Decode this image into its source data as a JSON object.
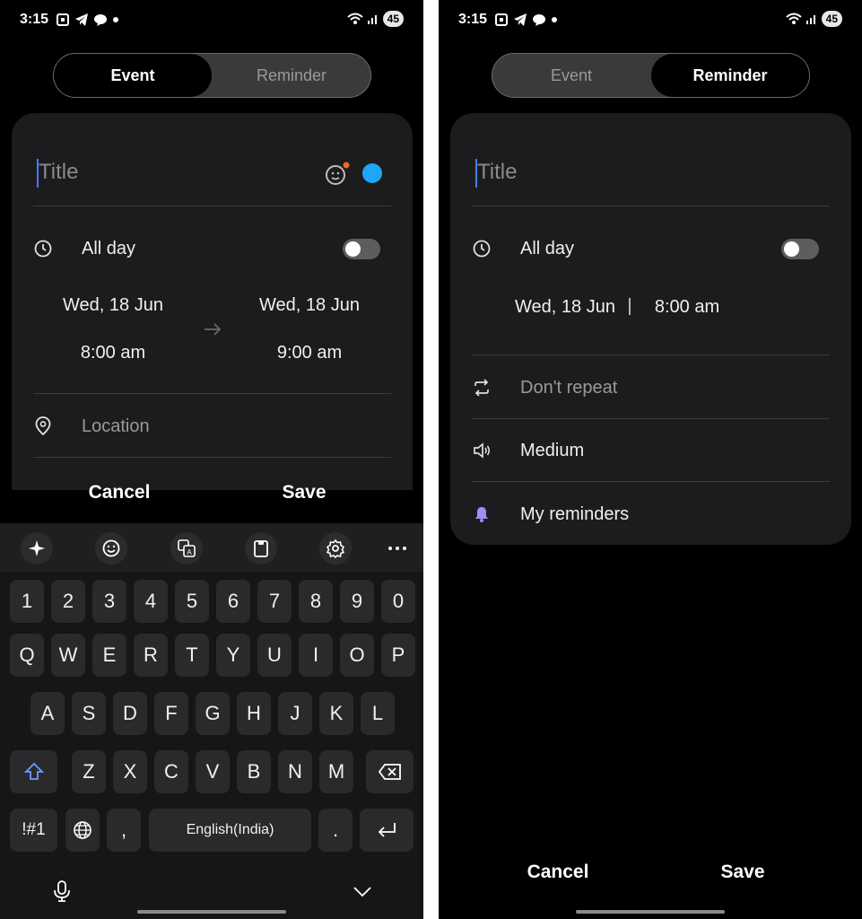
{
  "status": {
    "time": "3:15",
    "battery": "45"
  },
  "left": {
    "segmented": {
      "event": "Event",
      "reminder": "Reminder",
      "active": "Event"
    },
    "title_placeholder": "Title",
    "all_day": "All day",
    "start_date": "Wed, 18 Jun",
    "start_time": "8:00 am",
    "end_date": "Wed, 18 Jun",
    "end_time": "9:00 am",
    "location_placeholder": "Location",
    "cancel": "Cancel",
    "save": "Save",
    "colors": {
      "event_color": "#1fa6f5",
      "badge_dot": "#f06a1e"
    }
  },
  "keyboard": {
    "row_numbers": [
      "1",
      "2",
      "3",
      "4",
      "5",
      "6",
      "7",
      "8",
      "9",
      "0"
    ],
    "row1": [
      "Q",
      "W",
      "E",
      "R",
      "T",
      "Y",
      "U",
      "I",
      "O",
      "P"
    ],
    "row2": [
      "A",
      "S",
      "D",
      "F",
      "G",
      "H",
      "J",
      "K",
      "L"
    ],
    "row3": [
      "Z",
      "X",
      "C",
      "V",
      "B",
      "N",
      "M"
    ],
    "symbols": "!#1",
    "comma": ",",
    "space": "English(India)",
    "period": ".",
    "toolbar_icons": [
      "ai-sparkle-icon",
      "emoji-icon",
      "translate-icon",
      "clipboard-icon",
      "settings-icon",
      "more-icon"
    ]
  },
  "right": {
    "segmented": {
      "event": "Event",
      "reminder": "Reminder",
      "active": "Reminder"
    },
    "title_placeholder": "Title",
    "all_day": "All day",
    "date": "Wed, 18 Jun",
    "separator": "|",
    "time": "8:00 am",
    "repeat": "Don't repeat",
    "priority": "Medium",
    "list": "My reminders",
    "cancel": "Cancel",
    "save": "Save",
    "colors": {
      "bell": "#a48cf7"
    }
  }
}
